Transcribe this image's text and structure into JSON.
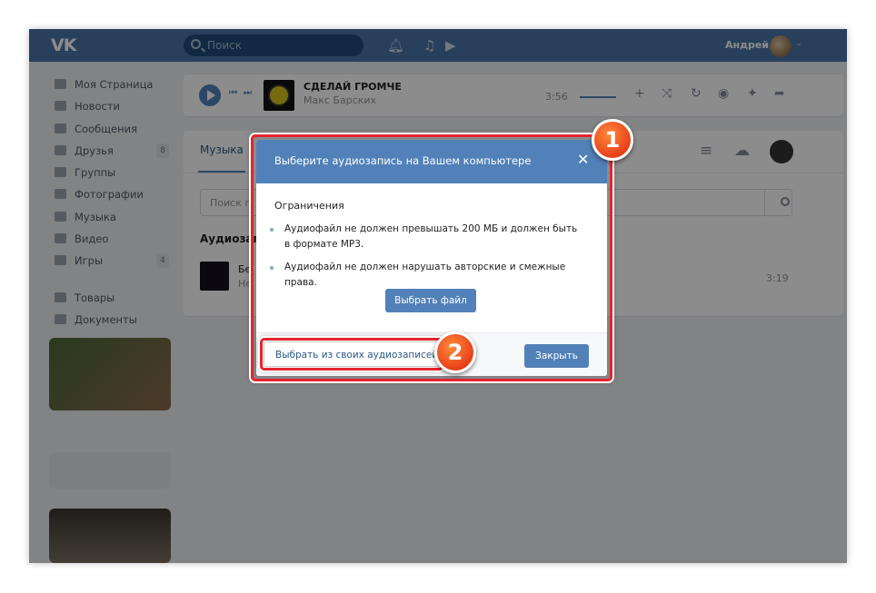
{
  "header": {
    "logo": "VK",
    "search_placeholder": "Поиск",
    "user_name": "Андрей"
  },
  "sidebar": {
    "items": [
      {
        "label": "Моя Страница",
        "icon": "home-icon",
        "badge": ""
      },
      {
        "label": "Новости",
        "icon": "news-icon",
        "badge": ""
      },
      {
        "label": "Сообщения",
        "icon": "messages-icon",
        "badge": ""
      },
      {
        "label": "Друзья",
        "icon": "friends-icon",
        "badge": "8"
      },
      {
        "label": "Группы",
        "icon": "groups-icon",
        "badge": ""
      },
      {
        "label": "Фотографии",
        "icon": "photos-icon",
        "badge": ""
      },
      {
        "label": "Музыка",
        "icon": "music-icon",
        "badge": ""
      },
      {
        "label": "Видео",
        "icon": "video-icon",
        "badge": ""
      },
      {
        "label": "Игры",
        "icon": "games-icon",
        "badge": "4"
      }
    ],
    "extra_items": [
      {
        "label": "Товары",
        "icon": "goods-icon"
      },
      {
        "label": "Документы",
        "icon": "documents-icon"
      }
    ]
  },
  "player": {
    "track_title": "СДЕЛАЙ ГРОМЧЕ",
    "artist": "Макс Барских",
    "time": "3:56"
  },
  "music": {
    "tab_label": "Музыка",
    "search_placeholder": "Поиск п",
    "section_title": "Аудиозап",
    "track_title": "Бе",
    "track_artist": "Не",
    "track_duration": "3:19"
  },
  "modal": {
    "title": "Выберите аудиозапись на Вашем компьютере",
    "limits_title": "Ограничения",
    "limit_1": "Аудиофайл не должен превышать 200 МБ и должен быть в формате MP3.",
    "limit_2": "Аудиофайл не должен нарушать авторские и смежные права.",
    "pick_file_button": "Выбрать файл",
    "choose_own_link": "Выбрать из своих аудиозаписей",
    "close_button": "Закрыть"
  },
  "annotations": {
    "step_1": "1",
    "step_2": "2"
  },
  "colors": {
    "header": "#4a76a8",
    "accent": "#5181b8",
    "highlight": "#e5252f",
    "badge": "#e8401a"
  }
}
